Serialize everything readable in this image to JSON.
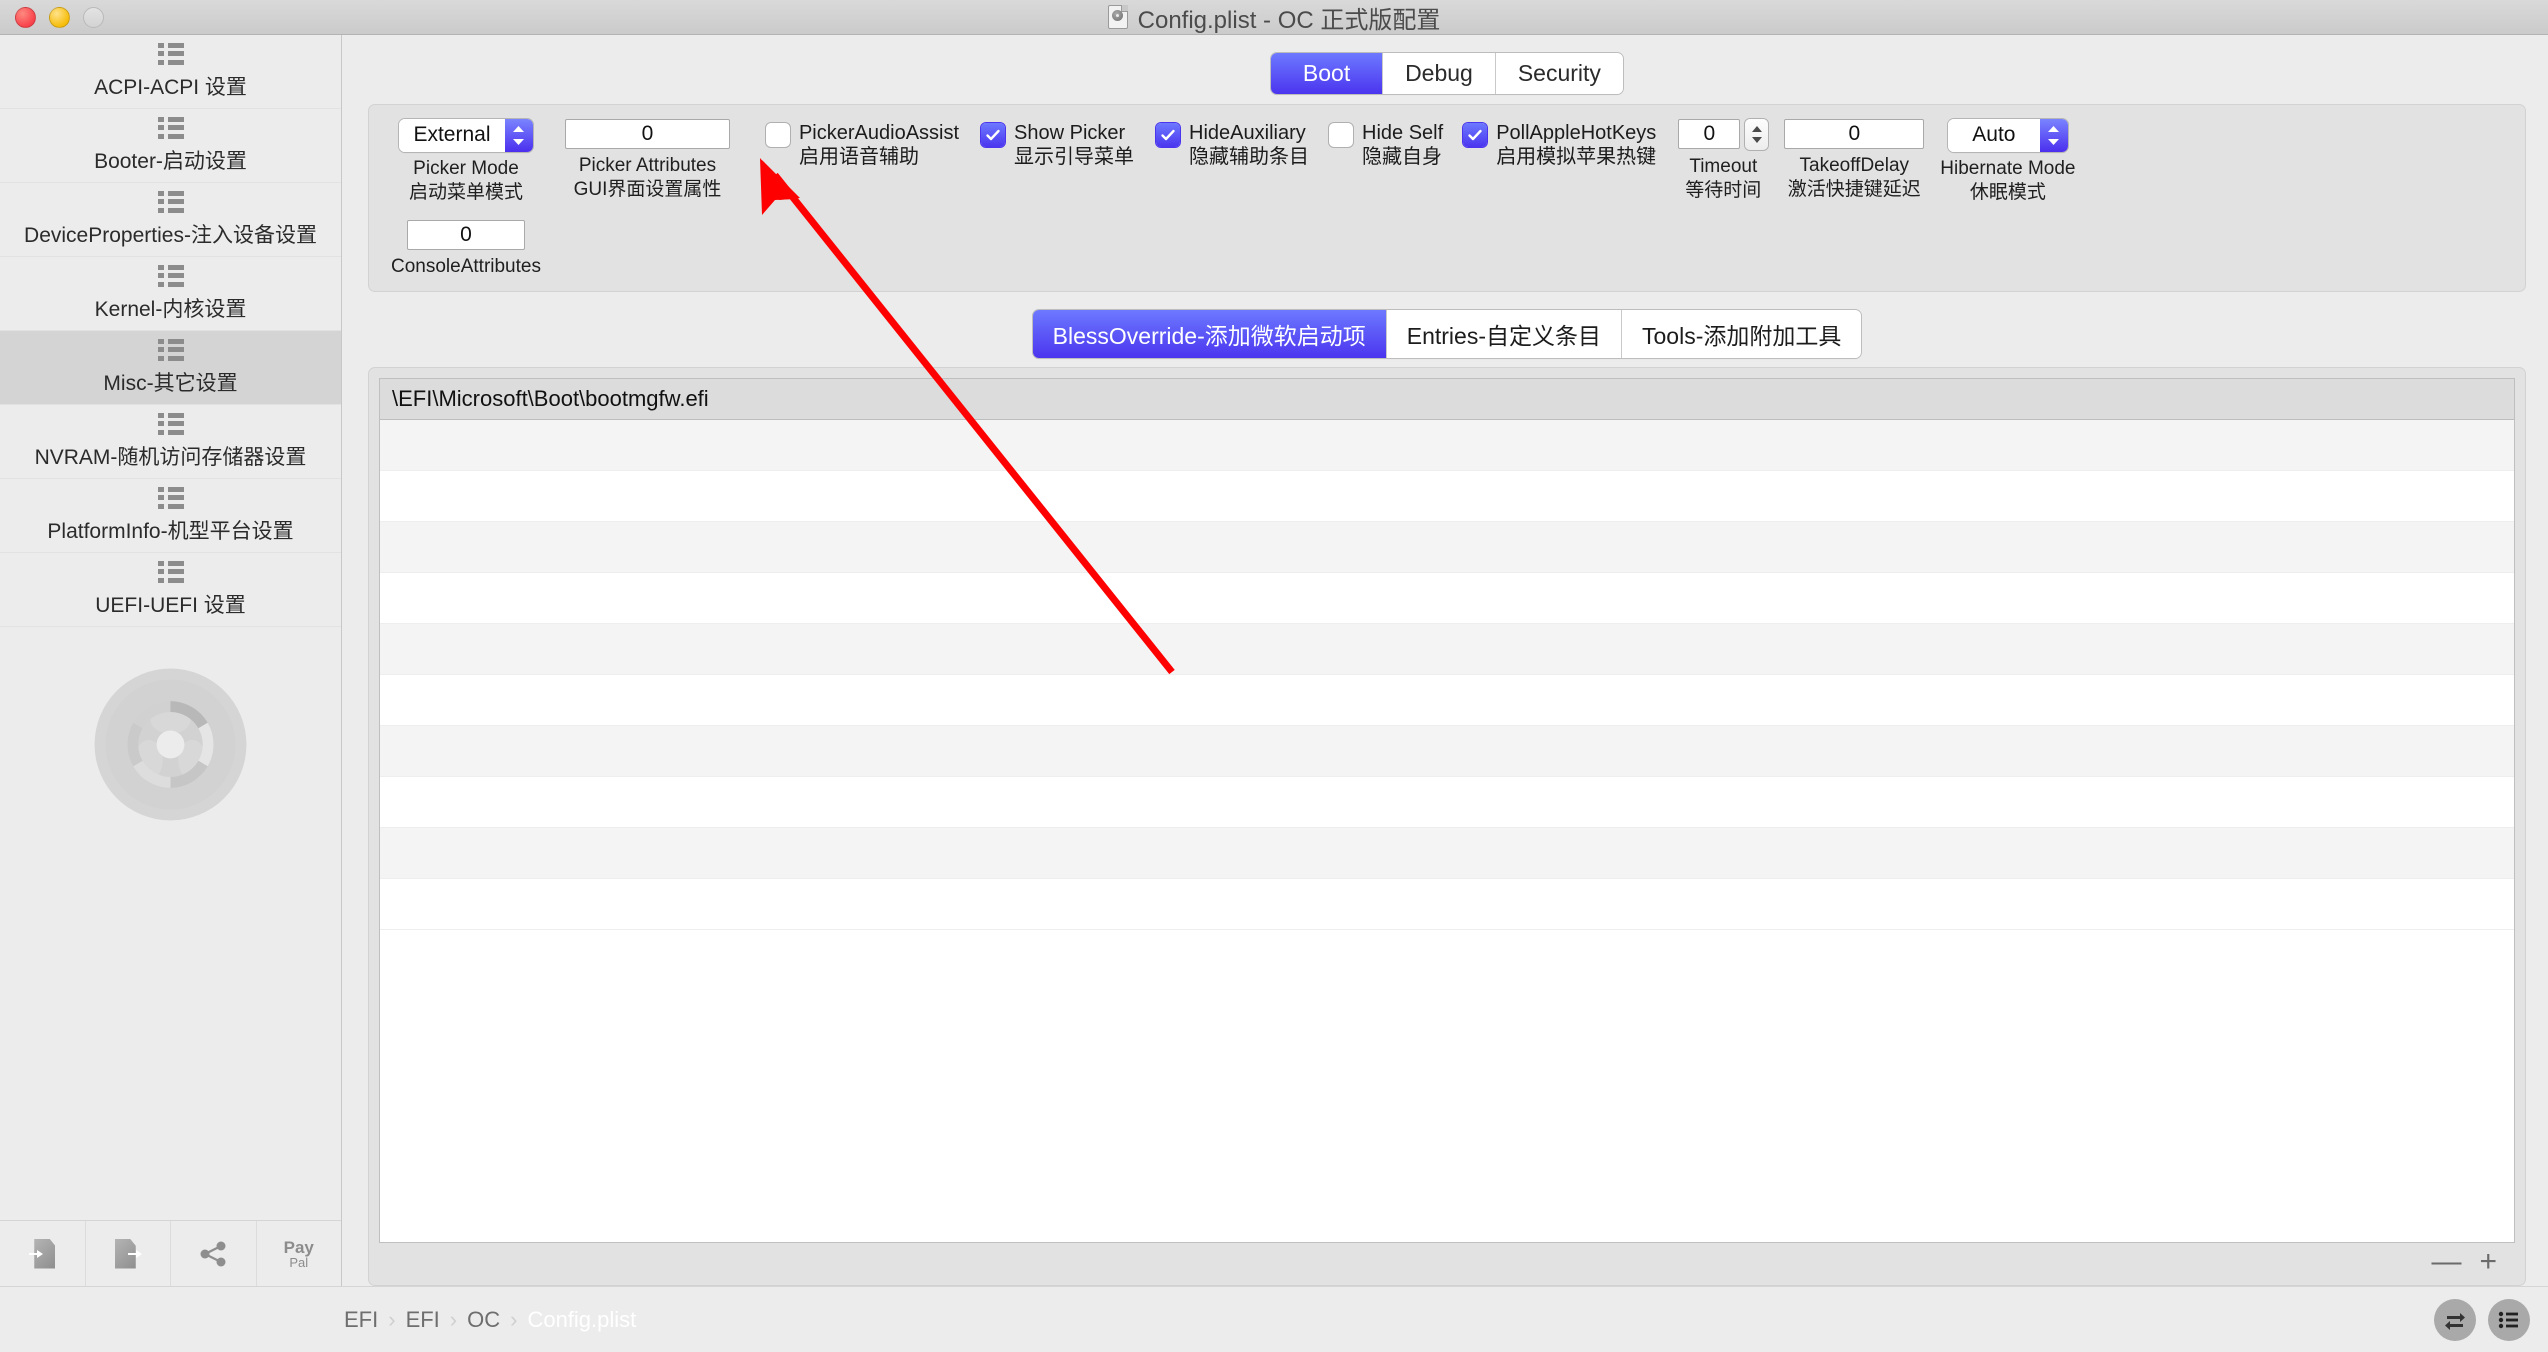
{
  "window": {
    "title": "Config.plist - OC 正式版配置",
    "traffic_lights": [
      "close",
      "minimize",
      "zoom"
    ]
  },
  "sidebar": {
    "items": [
      {
        "label": "ACPI-ACPI 设置",
        "selected": false
      },
      {
        "label": "Booter-启动设置",
        "selected": false
      },
      {
        "label": "DeviceProperties-注入设备设置",
        "selected": false
      },
      {
        "label": "Kernel-内核设置",
        "selected": false
      },
      {
        "label": "Misc-其它设置",
        "selected": true
      },
      {
        "label": "NVRAM-随机访问存储器设置",
        "selected": false
      },
      {
        "label": "PlatformInfo-机型平台设置",
        "selected": false
      },
      {
        "label": "UEFI-UEFI 设置",
        "selected": false
      }
    ],
    "toolbar": [
      {
        "icon": "import-document-icon",
        "label": ""
      },
      {
        "icon": "export-document-icon",
        "label": ""
      },
      {
        "icon": "share-icon",
        "label": ""
      },
      {
        "icon": "paypal-icon",
        "label": "Pay",
        "sublabel": "Pal"
      }
    ]
  },
  "tabs": {
    "items": [
      {
        "label": "Boot",
        "active": true
      },
      {
        "label": "Debug",
        "active": false
      },
      {
        "label": "Security",
        "active": false
      }
    ]
  },
  "boot_panel": {
    "picker_mode": {
      "value": "External",
      "caption_en": "Picker Mode",
      "caption_cn": "启动菜单模式"
    },
    "picker_attributes": {
      "value": "0",
      "caption_en": "Picker Attributes",
      "caption_cn": "GUI界面设置属性"
    },
    "console_attributes": {
      "value": "0",
      "caption_en": "ConsoleAttributes",
      "caption_cn": ""
    },
    "checkboxes": [
      {
        "en": "PickerAudioAssist",
        "cn": "启用语音辅助",
        "checked": false
      },
      {
        "en": "Show Picker",
        "cn": "显示引导菜单",
        "checked": true
      },
      {
        "en": "HideAuxiliary",
        "cn": "隐藏辅助条目",
        "checked": true
      },
      {
        "en": "Hide Self",
        "cn": "隐藏自身",
        "checked": false
      },
      {
        "en": "PollAppleHotKeys",
        "cn": "启用模拟苹果热键",
        "checked": true
      }
    ],
    "timeout": {
      "value": "0",
      "caption_en": "Timeout",
      "caption_cn": "等待时间"
    },
    "takeoff_delay": {
      "value": "0",
      "caption_en": "TakeoffDelay",
      "caption_cn": "激活快捷键延迟"
    },
    "hibernate_mode": {
      "value": "Auto",
      "caption_en": "Hibernate Mode",
      "caption_cn": "休眠模式"
    }
  },
  "inner_tabs": {
    "items": [
      {
        "label": "BlessOverride-添加微软启动项",
        "active": true
      },
      {
        "label": "Entries-自定义条目",
        "active": false
      },
      {
        "label": "Tools-添加附加工具",
        "active": false
      }
    ]
  },
  "table": {
    "header": "\\EFI\\Microsoft\\Boot\\bootmgfw.efi",
    "rows": [
      "",
      "",
      "",
      "",
      "",
      "",
      "",
      "",
      "",
      ""
    ],
    "remove_label": "—",
    "add_label": "+"
  },
  "statusbar": {
    "breadcrumb": [
      "EFI",
      "EFI",
      "OC",
      "Config.plist"
    ],
    "separator": "›",
    "buttons": [
      {
        "icon": "swap-arrows-icon"
      },
      {
        "icon": "list-view-icon"
      }
    ]
  },
  "colors": {
    "accent": "#4b35ef",
    "accent_light": "#6d79ff",
    "window_bg": "#ececec",
    "panel_bg": "#e2e2e2",
    "selected_row": "#d4d4d4",
    "annotation_red": "#ff0000"
  }
}
